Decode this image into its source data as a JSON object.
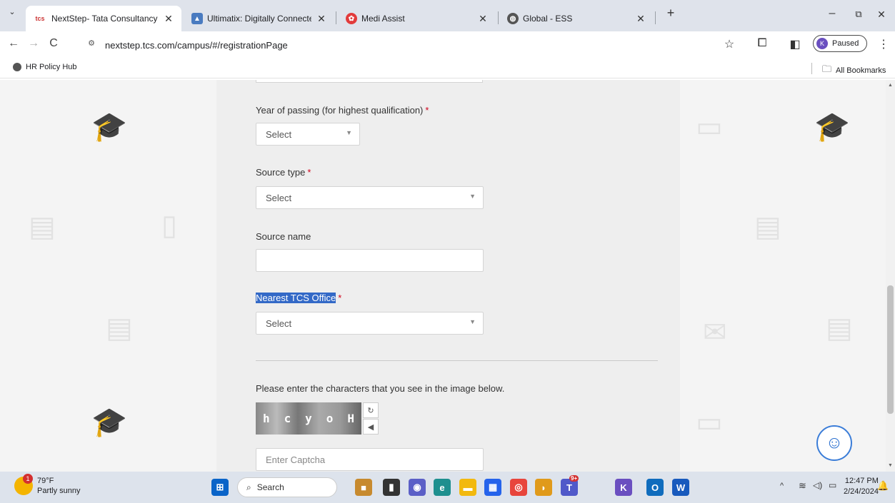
{
  "tabs": [
    {
      "favicon": "tcs",
      "title": "NextStep- Tata Consultancy Ser",
      "active": true
    },
    {
      "favicon": "ultimatix-icon",
      "title": "Ultimatix: Digitally Connected",
      "active": false
    },
    {
      "favicon": "medi-assist-icon",
      "title": "Medi Assist",
      "active": false
    },
    {
      "favicon": "globe-icon",
      "title": "Global - ESS",
      "active": false
    }
  ],
  "toolbar": {
    "url": "nextstep.tcs.com/campus/#/registrationPage",
    "profile_initial": "K",
    "profile_status": "Paused"
  },
  "bookmarks": {
    "left": "HR Policy Hub",
    "right": "All Bookmarks"
  },
  "form": {
    "year_label": "Year of passing (for highest qualification)",
    "year_value": "Select",
    "source_type_label": "Source type",
    "source_type_value": "Select",
    "source_name_label": "Source name",
    "source_name_value": "",
    "office_label": "Nearest TCS Office",
    "office_value": "Select",
    "required_mark": "*",
    "captcha_prompt": "Please enter the characters that you see in the image below.",
    "captcha_chars": [
      "h",
      "c",
      "y",
      "o",
      "H"
    ],
    "captcha_placeholder": "Enter Captcha"
  },
  "taskbar": {
    "weather_temp": "79°F",
    "weather_desc": "Partly sunny",
    "weather_badge": "1",
    "search_label": "Search",
    "time": "12:47 PM",
    "date": "2/24/2024",
    "teams_badge": "9+"
  },
  "colors": {
    "selection": "#3369c7",
    "required": "#d0021b",
    "tab_strip": "#dfe3eb",
    "taskbar": "#dde3ec"
  }
}
